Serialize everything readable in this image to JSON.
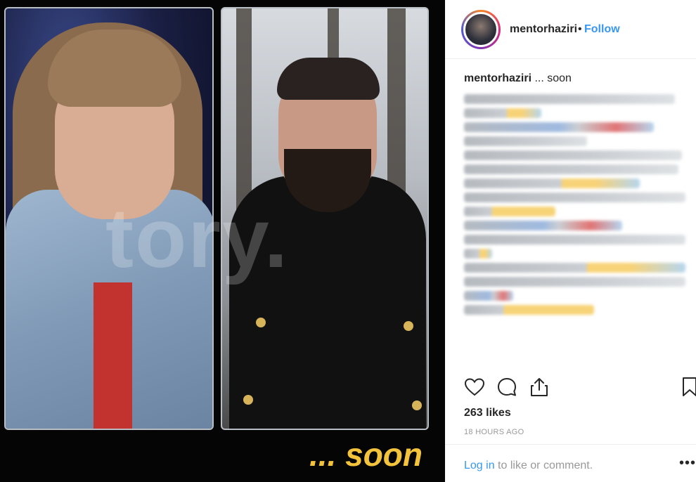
{
  "media": {
    "overlay_text": "... soon",
    "watermark": "tory.",
    "icons": {
      "left_panel": "portrait-photo",
      "right_panel": "portrait-photo"
    }
  },
  "header": {
    "username": "mentorhaziri",
    "separator": "•",
    "follow_label": "Follow",
    "icons": {
      "avatar": "profile-avatar"
    }
  },
  "caption": {
    "username": "mentorhaziri",
    "text": "... soon"
  },
  "actions": {
    "icons": [
      "heart-icon",
      "comment-icon",
      "share-icon",
      "bookmark-icon"
    ]
  },
  "likes": "263 likes",
  "timestamp": "18 HOURS AGO",
  "footer": {
    "login_link": "Log in",
    "login_rest": " to like or comment.",
    "more": "•••"
  },
  "colors": {
    "link": "#3897f0",
    "text": "#262626",
    "muted": "#999999",
    "accent_soon": "#f2c33b"
  }
}
